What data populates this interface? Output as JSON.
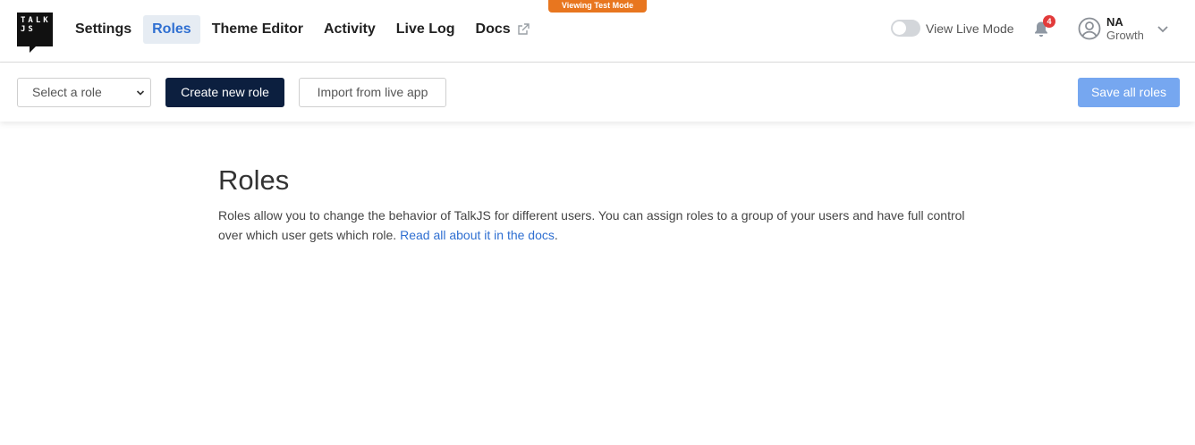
{
  "logo": {
    "line1": "TALK",
    "line2": "JS"
  },
  "mode_badge": "Viewing Test Mode",
  "nav": {
    "items": [
      {
        "label": "Settings"
      },
      {
        "label": "Roles",
        "active": true
      },
      {
        "label": "Theme Editor"
      },
      {
        "label": "Activity"
      },
      {
        "label": "Live Log"
      },
      {
        "label": "Docs",
        "icon": "external-link-icon"
      }
    ]
  },
  "live_mode": {
    "label": "View Live Mode",
    "enabled": false
  },
  "notifications": {
    "icon": "bell-icon",
    "count": "4"
  },
  "user": {
    "initials": "NA",
    "plan": "Growth",
    "icon": "user-circle-icon"
  },
  "toolbar": {
    "select_placeholder": "Select a role",
    "create_label": "Create new role",
    "import_label": "Import from live app",
    "save_label": "Save all roles"
  },
  "main": {
    "title": "Roles",
    "description": "Roles allow you to change the behavior of TalkJS for different users. You can assign roles to a group of your users and have full control over which user gets which role. ",
    "link_text": "Read all about it in the docs",
    "trailing": "."
  },
  "colors": {
    "accent": "#2f6fd1",
    "primary_button": "#0c1f3f",
    "save_button": "#76a7f0",
    "badge": "#e8761f",
    "notification": "#e23b3b"
  }
}
